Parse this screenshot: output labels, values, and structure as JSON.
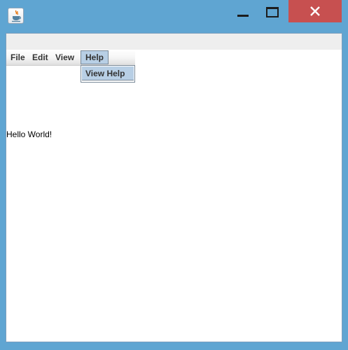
{
  "window": {
    "accent_color": "#5fa5d2",
    "close_color": "#c75050",
    "icon": "java-cup-icon",
    "controls": [
      "minimize-icon",
      "maximize-icon",
      "close-icon"
    ]
  },
  "menubar": {
    "file": "File",
    "edit": "Edit",
    "view": "View",
    "help": "Help"
  },
  "help_menu": {
    "open": true,
    "items": [
      "View Help"
    ],
    "highlight_color": "#b8cfe5"
  },
  "content": {
    "label": "Hello World!"
  }
}
